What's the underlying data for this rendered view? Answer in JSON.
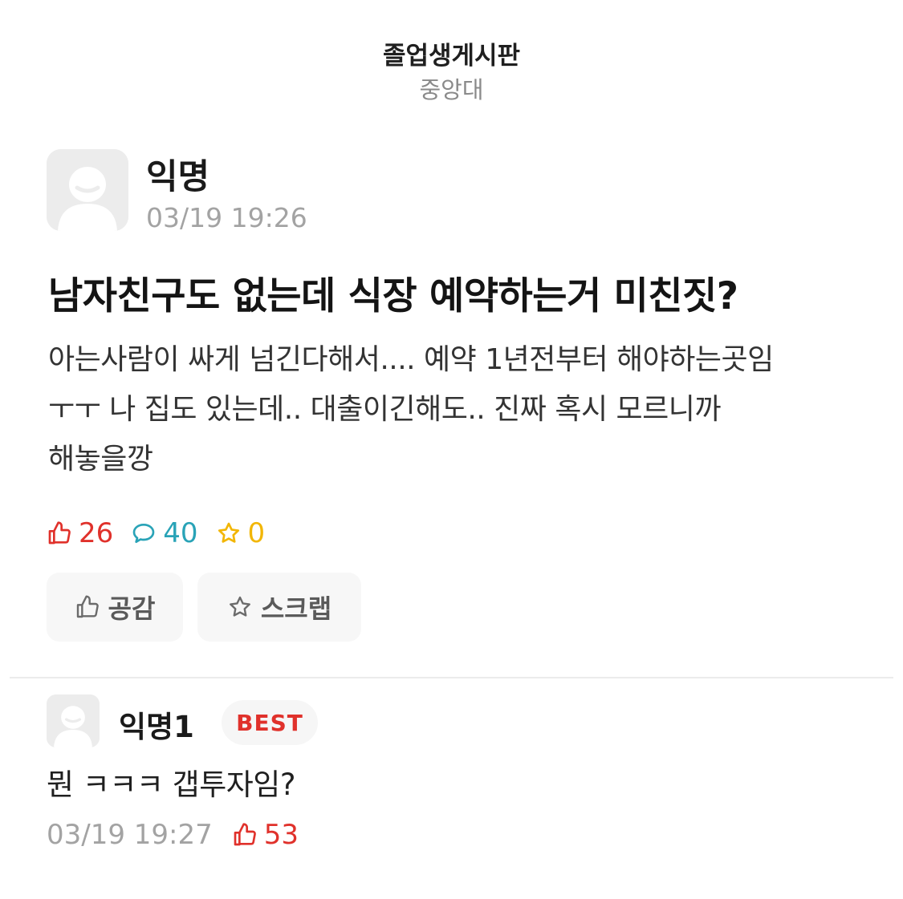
{
  "header": {
    "board_title": "졸업생게시판",
    "school": "중앙대"
  },
  "post": {
    "author": "익명",
    "time": "03/19 19:26",
    "title": "남자친구도 없는데 식장 예약하는거 미친짓?",
    "body_lines": [
      "아는사람이 싸게 넘긴다해서.... 예약 1년전부터 해야하는곳임",
      "ㅜㅜ 나 집도 있는데.. 대출이긴해도.. 진짜 혹시 모르니까",
      "해놓을깡"
    ],
    "stats": {
      "likes": "26",
      "comments": "40",
      "scraps": "0"
    },
    "actions": {
      "like_label": "공감",
      "scrap_label": "스크랩"
    }
  },
  "comment": {
    "author": "익명1",
    "badge": "BEST",
    "text": "뭔 ㅋㅋㅋ 갭투자임?",
    "time": "03/19 19:27",
    "likes": "53"
  },
  "colors": {
    "like_red": "#e0312b",
    "comment_teal": "#29a3b7",
    "scrap_yellow": "#f2b605",
    "muted_gray": "#a3a3a3"
  },
  "icons": {
    "like": "thumbs-up-icon",
    "comment": "speech-bubble-icon",
    "scrap": "star-icon",
    "avatar": "anonymous-avatar-icon"
  }
}
